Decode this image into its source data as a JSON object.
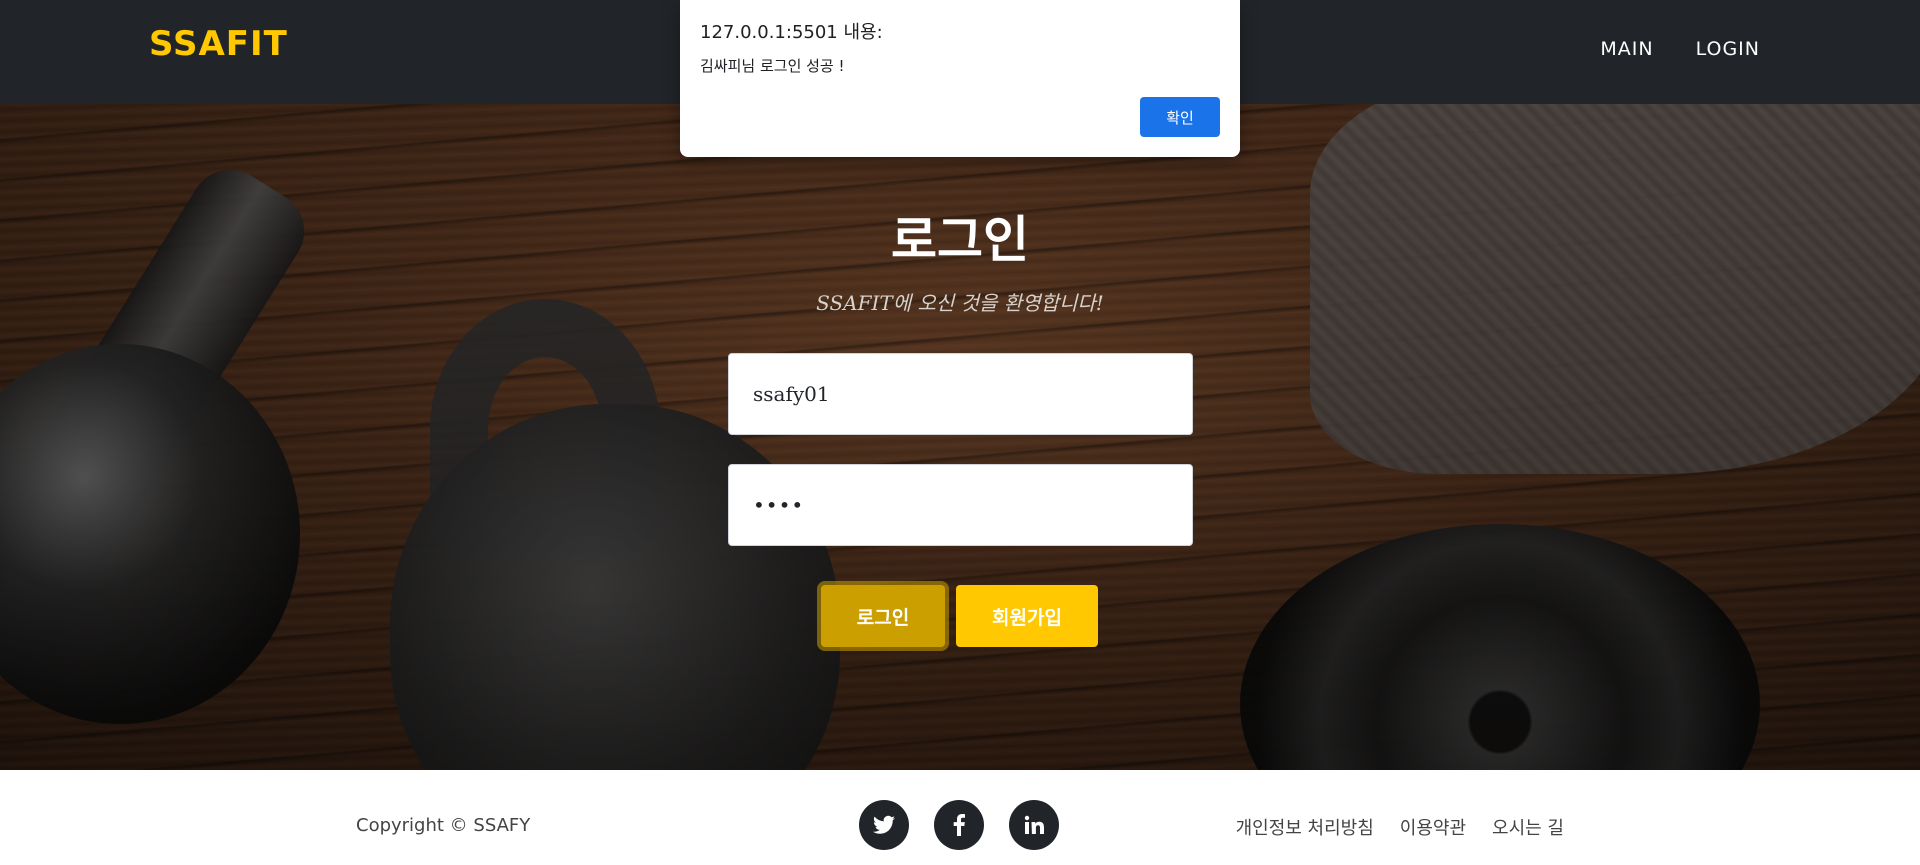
{
  "navbar": {
    "brand": "SSAFIT",
    "links": [
      "MAIN",
      "LOGIN"
    ],
    "brand_color": "#ffc800",
    "background": "#212529"
  },
  "hero": {
    "title": "로그인",
    "subtitle": "SSAFIT에 오신 것을 환영합니다!",
    "id_value": "ssafy01",
    "password_value": "••••",
    "login_button": "로그인",
    "signup_button": "회원가입"
  },
  "footer": {
    "copyright": "Copyright © SSAFY",
    "social_icons": [
      "twitter-icon",
      "facebook-icon",
      "linkedin-icon"
    ],
    "links": [
      "개인정보 처리방침",
      "이용약관",
      "오시는 길"
    ]
  },
  "dialog": {
    "origin": "127.0.0.1:5501 내용:",
    "message": "김싸피님 로그인 성공 !",
    "ok_button": "확인",
    "button_color": "#1a73e8"
  }
}
